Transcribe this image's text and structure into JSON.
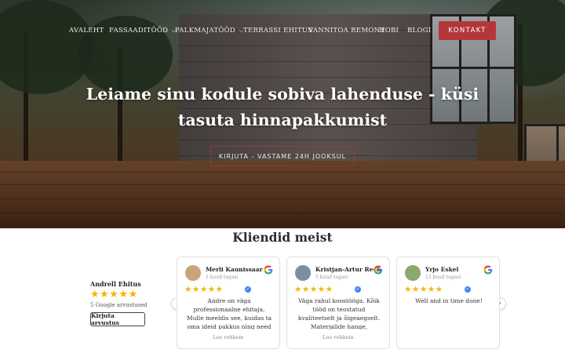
{
  "nav": {
    "items": [
      {
        "label": "AVALEHT",
        "has_dropdown": false
      },
      {
        "label": "FASSAADITÖÖD",
        "has_dropdown": true
      },
      {
        "label": "PALKMAJATÖÖD",
        "has_dropdown": true
      },
      {
        "label": "TERRASSI EHITUS",
        "has_dropdown": false
      },
      {
        "label": "VANNITOA REMONT",
        "has_dropdown": false
      },
      {
        "label": "HOBI",
        "has_dropdown": false
      },
      {
        "label": "BLOGI",
        "has_dropdown": false
      }
    ],
    "chevron": "⌵",
    "contact_label": "KONTAKT",
    "accent_color": "#b3373a"
  },
  "hero": {
    "title": "Leiame sinu kodule sobiva lahenduse - küsi tasuta hinnapakkumist",
    "cta_label": "KIRJUTA - VASTAME 24H JOOKSUL"
  },
  "reviews": {
    "section_title": "Kliendid meist",
    "summary": {
      "business_name": "Andrell Ehitus",
      "stars": "★★★★★",
      "count_text": "5 Google arvustused",
      "write_button": "Kirjuta arvustus"
    },
    "prev_arrow": "‹",
    "next_arrow": "›",
    "items": [
      {
        "name": "Merli Kaunissaar",
        "time": "1 kuud tagasi",
        "stars": "★★★★★",
        "text": "Andre on väga professionaalne ehitaja. Mulle meeldis see, kuidas ta oma ideid pakkus ning need perfektselt ellu viis. Kuna",
        "more": "Loe rohkem",
        "avatar_color": "#c9a27e"
      },
      {
        "name": "Kristjan-Artur Reek",
        "time": "5 kuud tagasi",
        "stars": "★★★★★",
        "text": "Väga rahul koostööga. Kõik tööd on teostatud kvaliteetselt ja õigeaegselt. Materjalide hange, lahenduste leidmine, tööetika...",
        "more": "Loe rohkem",
        "avatar_color": "#7a8fa6"
      },
      {
        "name": "Yrjo Eskel",
        "time": "12 kuud tagasi",
        "stars": "★★★★★",
        "text": "Well and in time done!",
        "more": "",
        "avatar_color": "#8aa86f"
      }
    ]
  }
}
